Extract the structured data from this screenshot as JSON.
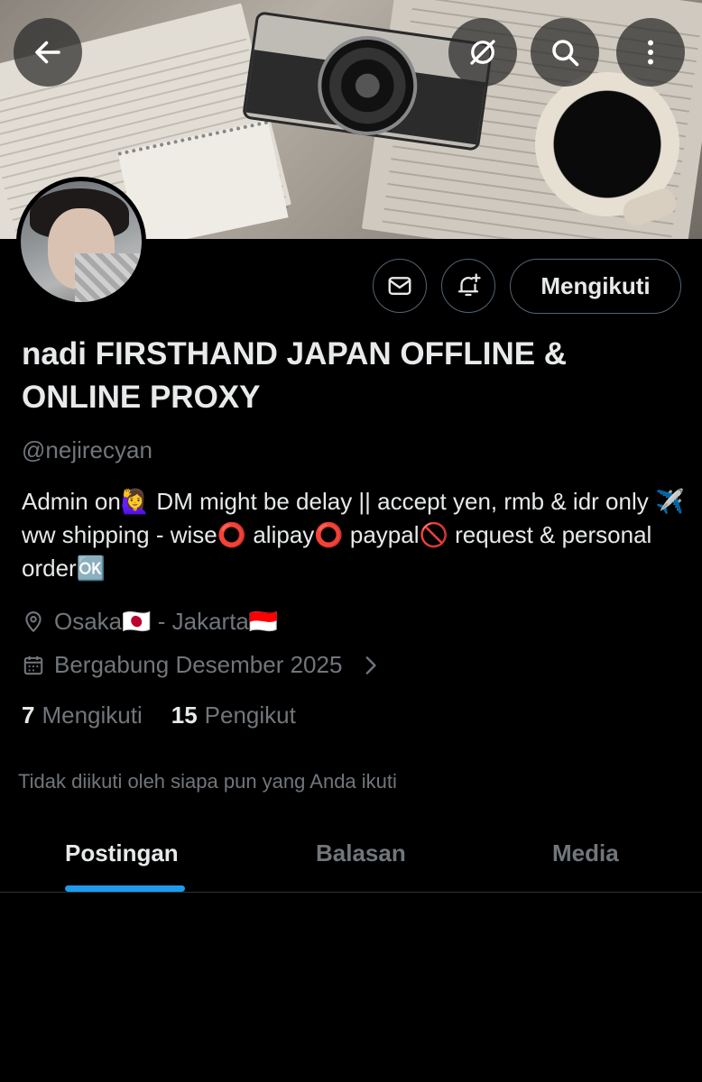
{
  "profile": {
    "display_name": "nadi FIRSTHAND JAPAN OFFLINE & ONLINE PROXY",
    "handle": "@nejirecyan",
    "bio": "Admin on🙋‍♀️ DM might be delay || accept yen, rmb & idr only ✈️ ww shipping - wise⭕ alipay⭕ paypal🚫 request & personal order🆗",
    "location": "Osaka🇯🇵 - Jakarta🇮🇩",
    "joined": "Bergabung Desember 2025",
    "following_count": "7",
    "following_label": "Mengikuti",
    "followers_count": "15",
    "followers_label": "Pengikut",
    "followed_by_notice": "Tidak diikuti oleh siapa pun yang Anda ikuti"
  },
  "actions": {
    "follow_label": "Mengikuti"
  },
  "tabs": [
    {
      "label": "Postingan",
      "active": true
    },
    {
      "label": "Balasan",
      "active": false
    },
    {
      "label": "Media",
      "active": false
    }
  ],
  "icons": {
    "back": "arrow-left-icon",
    "grok": "slash-circle-icon",
    "search": "search-icon",
    "more": "more-vertical-icon",
    "message": "envelope-icon",
    "notify": "bell-plus-icon",
    "location": "location-pin-icon",
    "calendar": "calendar-icon",
    "chevron": "chevron-right-icon"
  },
  "colors": {
    "accent": "#1d9bf0",
    "text_primary": "#e7e9ea",
    "text_secondary": "#71767b",
    "border": "#536471",
    "background": "#000000"
  }
}
